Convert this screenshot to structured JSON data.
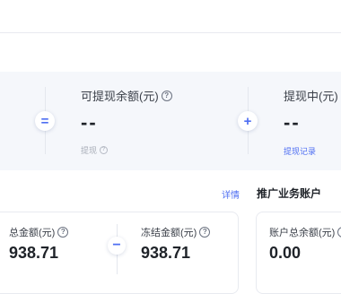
{
  "balance": {
    "equals_symbol": "=",
    "withdrawable": {
      "label": "可提现余额(元)",
      "value": "--",
      "action_label": "提现"
    },
    "plus_symbol": "+",
    "withdrawing": {
      "label": "提现中(元)",
      "value": "--",
      "action_label": "提现记录"
    }
  },
  "detail_link": "详情",
  "promo_account": {
    "title": "推广业务账户"
  },
  "cards": {
    "total": {
      "label": "总金额(元)",
      "value": "938.71"
    },
    "minus_symbol": "−",
    "frozen": {
      "label": "冻结金额(元)",
      "value": "938.71"
    },
    "account_total": {
      "label": "账户总余额(元)",
      "value": "0.00"
    }
  },
  "icons": {
    "help": "question-circle-icon"
  },
  "colors": {
    "accent": "#4e6ef2",
    "band_bg": "#f5f7fb"
  }
}
